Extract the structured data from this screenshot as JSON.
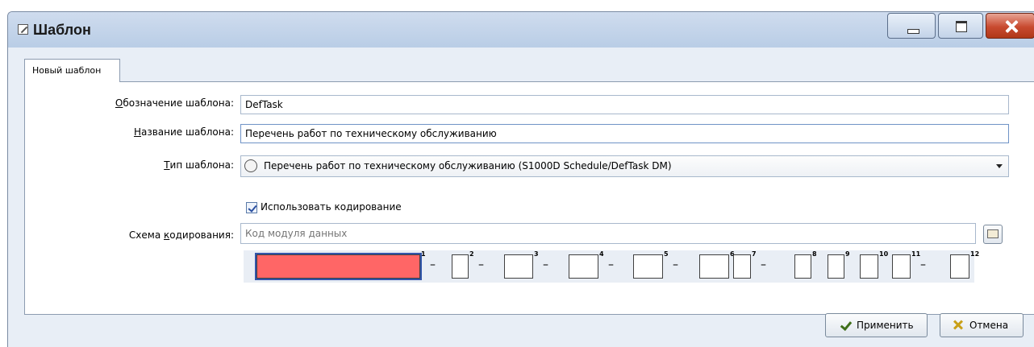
{
  "window": {
    "title": "Шаблон"
  },
  "tab": {
    "label": "Новый шаблон"
  },
  "form": {
    "designation_label": "Обозначение шаблона:",
    "designation_value": "DefTask",
    "name_label": "Название шаблона:",
    "name_value": "Перечень работ по техническому обслуживанию",
    "type_label": "Тип шаблона:",
    "type_value": "Перечень работ по техническому обслуживанию (S1000D Schedule/DefTask DM)",
    "use_coding_label": "Использовать кодирование",
    "use_coding_checked": true,
    "scheme_label": "Схема кодирования:",
    "scheme_placeholder": "Код модуля данных",
    "segment_numbers": [
      "1",
      "2",
      "3",
      "4",
      "5",
      "6",
      "7",
      "8",
      "9",
      "10",
      "11",
      "12"
    ],
    "segment_dash": "–",
    "active_segment_color": "#ff6666"
  },
  "buttons": {
    "apply": "Применить",
    "cancel": "Отмена"
  }
}
